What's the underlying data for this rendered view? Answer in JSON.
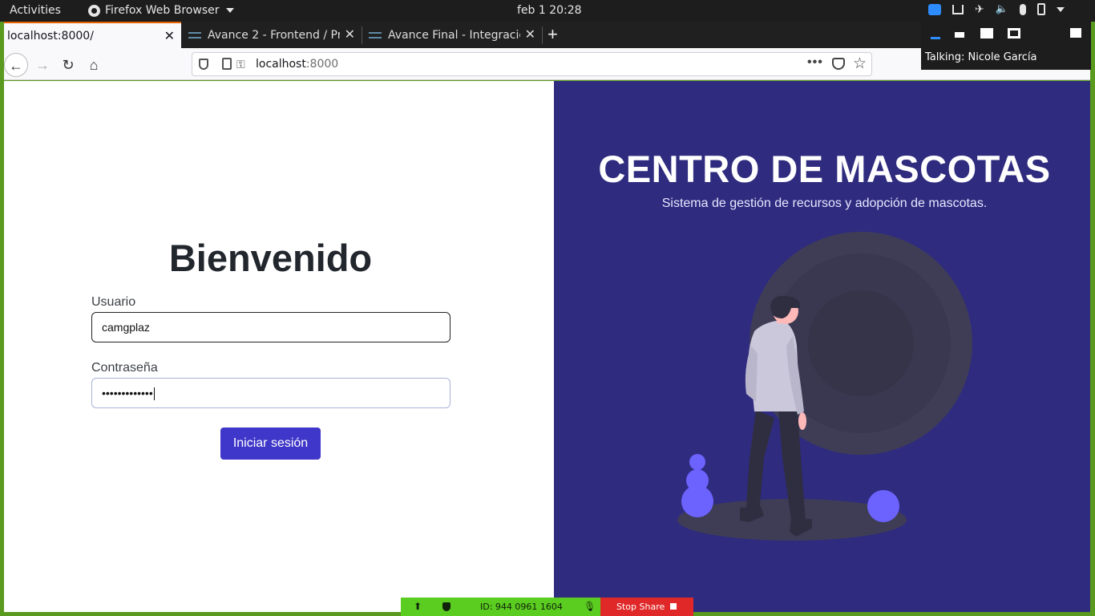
{
  "system_bar": {
    "activities": "Activities",
    "app_menu": "Firefox Web Browser",
    "clock": "feb 1  20:28"
  },
  "browser": {
    "tabs": [
      {
        "title": "localhost:8000/",
        "active": true
      },
      {
        "title": "Avance 2 - Frontend / Pro",
        "active": false
      },
      {
        "title": "Avance Final - Integració",
        "active": false
      }
    ],
    "url_host": "localhost",
    "url_port": ":8000"
  },
  "zoom": {
    "talking": "Talking: Nicole García",
    "meeting_id": "ID: 944 0961 1604",
    "stop_share": "Stop Share"
  },
  "login": {
    "heading": "Bienvenido",
    "user_label": "Usuario",
    "user_value": "camgplaz",
    "pass_label": "Contraseña",
    "pass_value": "•••••••••••••",
    "submit_label": "Iniciar sesión"
  },
  "brand": {
    "title": "CENTRO DE MASCOTAS",
    "subtitle": "Sistema de gestión de recursos y adopción de mascotas."
  },
  "colors": {
    "brand_panel": "#2f2b7f",
    "button": "#3f37c9",
    "accent_purple": "#6c63ff",
    "zoom_green": "#5bcc20",
    "zoom_red": "#e02828"
  }
}
